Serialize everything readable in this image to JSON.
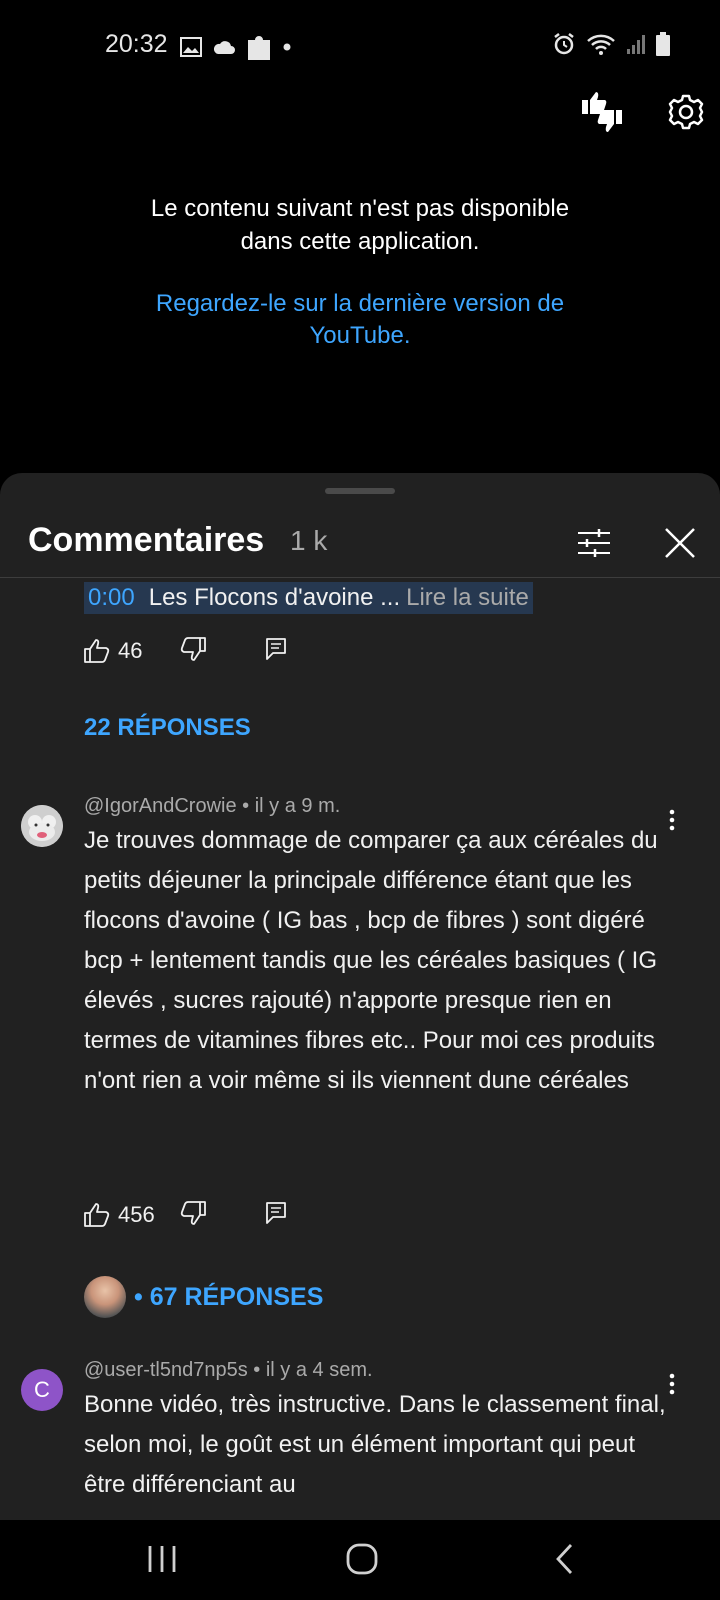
{
  "status_bar": {
    "time": "20:32",
    "icons_left": [
      "image-icon",
      "cloud-icon",
      "puzzle-icon",
      "dot-icon"
    ],
    "icons_right": [
      "alarm-icon",
      "wifi-icon",
      "signal-icon",
      "battery-icon"
    ]
  },
  "player": {
    "unavailable_line1": "Le contenu suivant n'est pas disponible",
    "unavailable_line2": "dans cette application.",
    "watch_link_line1": "Regardez-le sur la dernière version de",
    "watch_link_line2": "YouTube."
  },
  "comments_sheet": {
    "title": "Commentaires",
    "count": "1 k",
    "first_thread": {
      "timestamp": "0:00",
      "text": "Les Flocons d'avoine ...",
      "read_more": "Lire la suite",
      "likes": "46",
      "replies_label": "22 RÉPONSES"
    },
    "comments": [
      {
        "author": "@IgorAndCrowie",
        "age": "il y a 9 m.",
        "meta": "@IgorAndCrowie • il y a 9 m.",
        "body": "Je trouves dommage de comparer ça aux céréales du petits déjeuner la principale différence étant que les flocons d'avoine ( IG bas , bcp de fibres ) sont digéré bcp + lentement tandis que les céréales basiques ( IG élevés , sucres rajouté) n'apporte presque rien en termes de vitamines fibres etc.. Pour moi ces produits n'ont rien a voir même si ils viennent dune céréales",
        "likes": "456",
        "replies_label": "• 67 RÉPONSES"
      },
      {
        "author": "@user-tl5nd7np5s",
        "age": "il y a 4 sem.",
        "meta": "@user-tl5nd7np5s • il y a 4 sem.",
        "avatar_letter": "C",
        "avatar_color": "#8e54c8",
        "body": "Bonne vidéo, très instructive. Dans le classement final, selon moi, le goût est un élément important qui peut être différenciant au"
      }
    ]
  },
  "colors": {
    "link_blue": "#3ea6ff",
    "sheet_bg": "#212121",
    "secondary_text": "#aaaaaa"
  }
}
